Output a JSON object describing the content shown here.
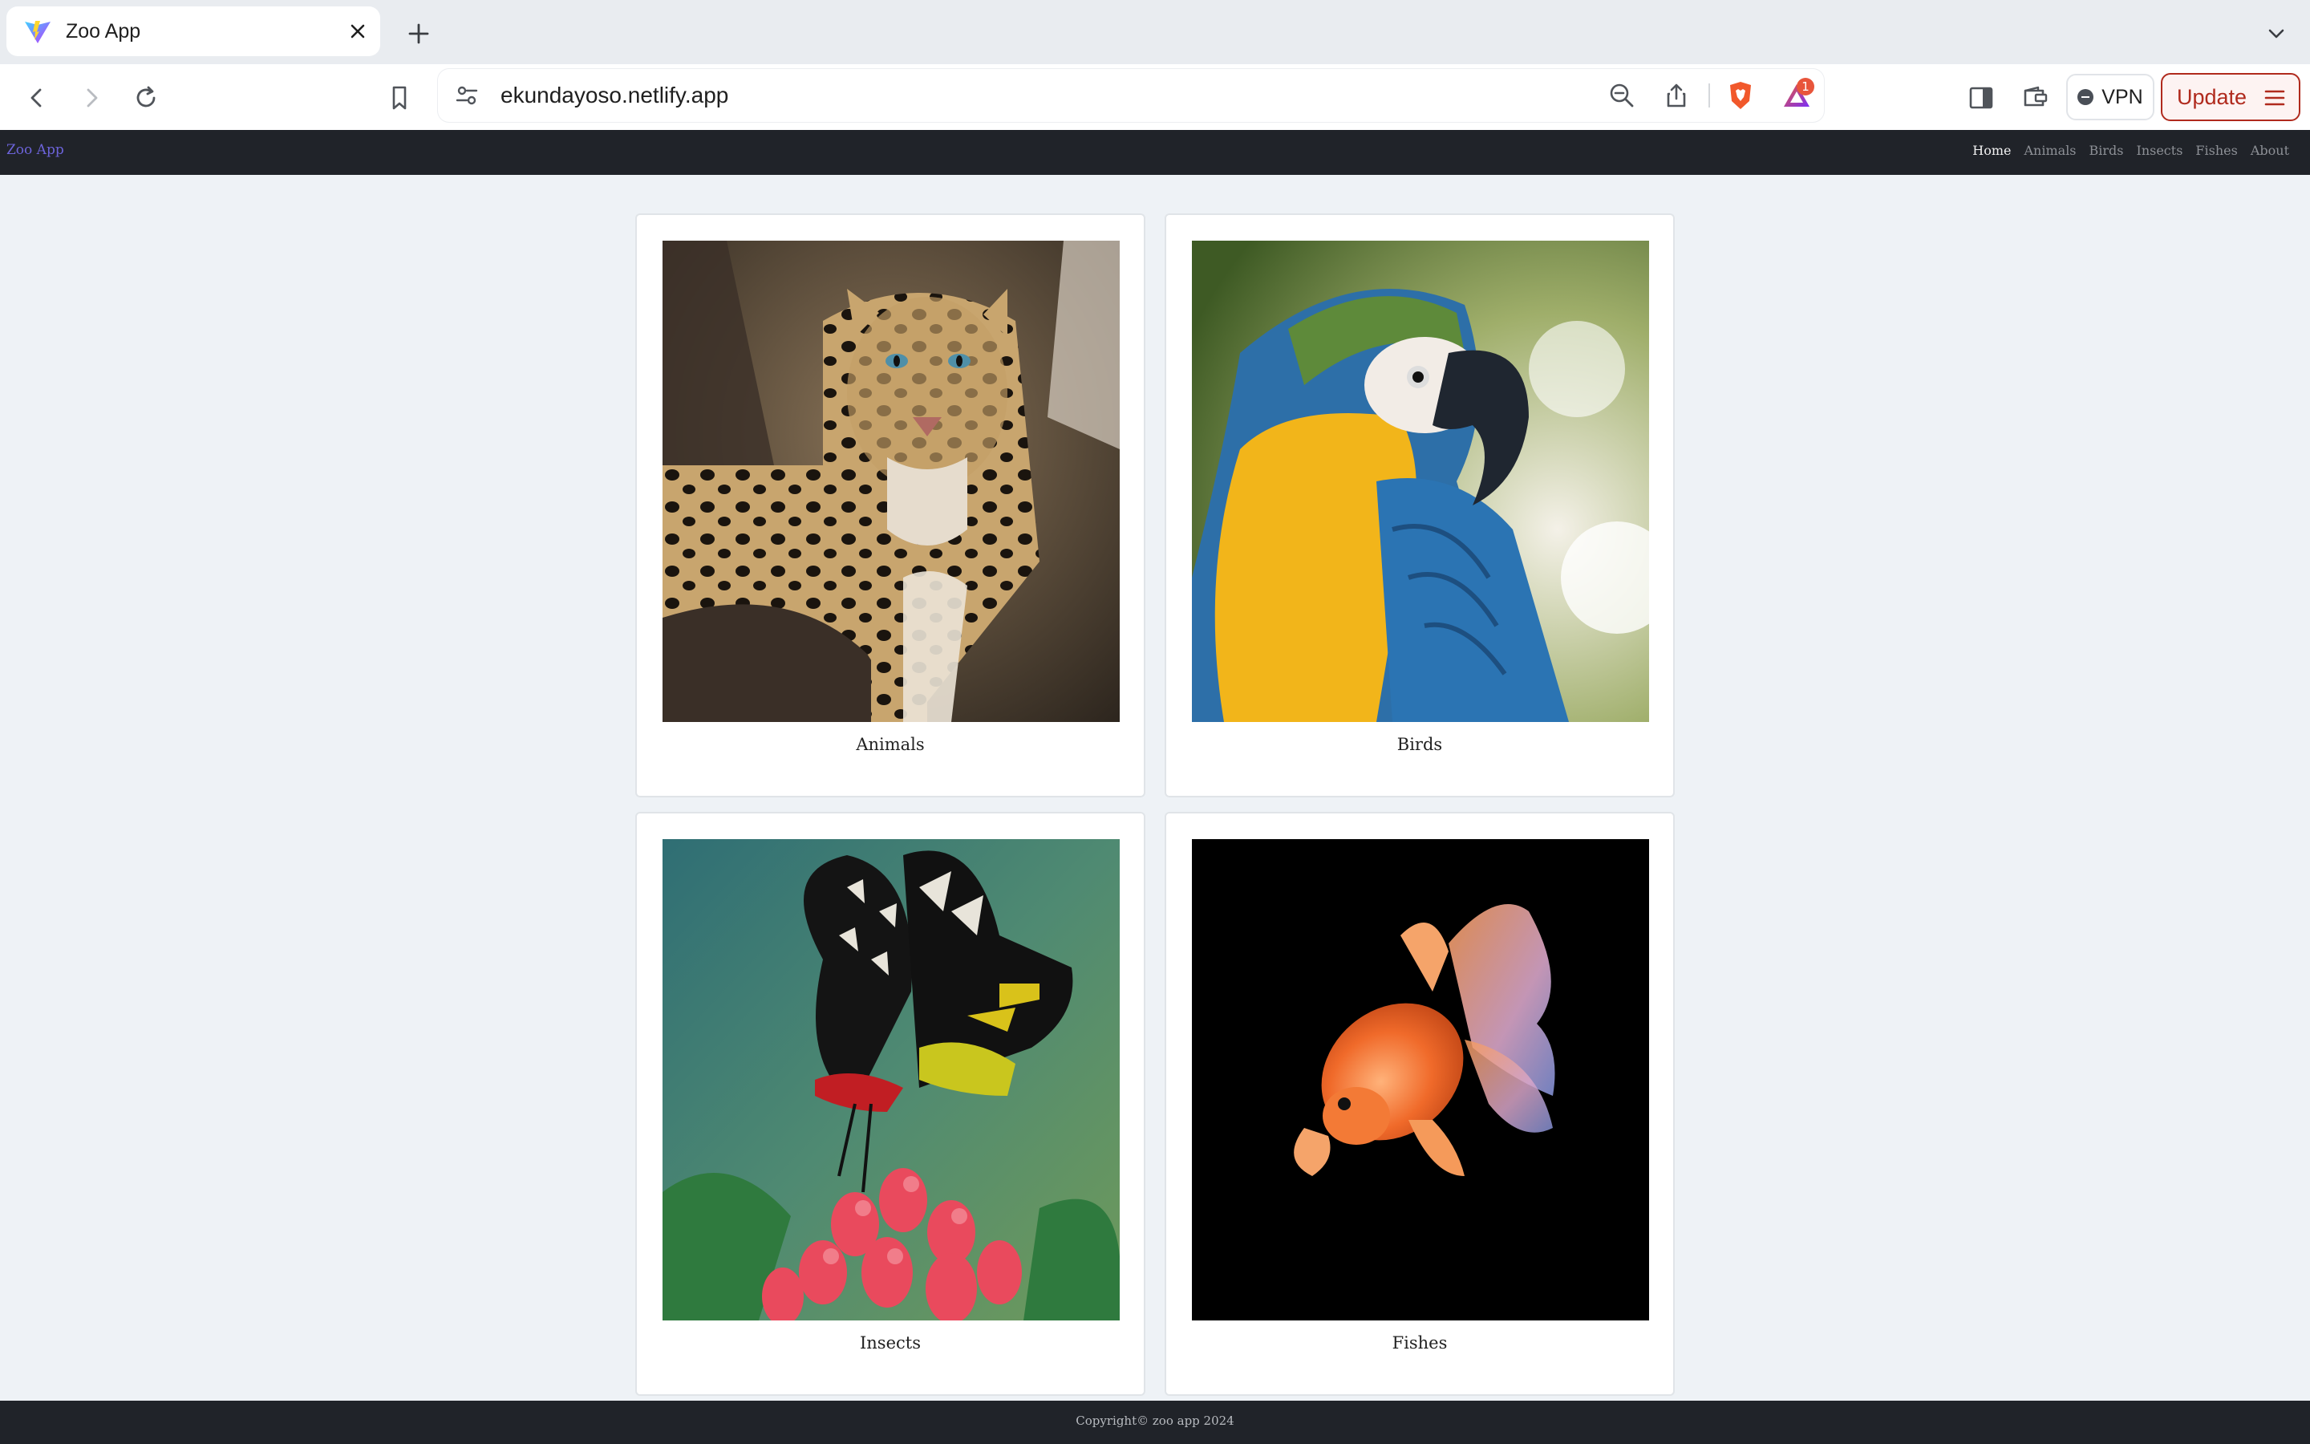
{
  "browser": {
    "tab": {
      "title": "Zoo App",
      "favicon": "vite-logo-icon"
    },
    "new_tab_icon": "plus-icon",
    "tab_list_icon": "chevron-down-icon",
    "url": "ekundayoso.netlify.app",
    "shields_badge_count": "1",
    "vpn_label": "VPN",
    "update_label": "Update",
    "colors": {
      "update_accent": "#b02a1d",
      "brave_orange": "#f1582b"
    }
  },
  "site": {
    "brand": "Zoo App",
    "nav": {
      "home": "Home",
      "animals": "Animals",
      "birds": "Birds",
      "insects": "Insects",
      "fishes": "Fishes",
      "about": "About"
    },
    "cards": {
      "animals": {
        "label": "Animals",
        "image": "leopard-photo"
      },
      "birds": {
        "label": "Birds",
        "image": "macaw-parrot-photo"
      },
      "insects": {
        "label": "Insects",
        "image": "butterfly-on-flower-photo"
      },
      "fishes": {
        "label": "Fishes",
        "image": "goldfish-photo"
      }
    },
    "footer": "Copyright© zoo app 2024"
  }
}
